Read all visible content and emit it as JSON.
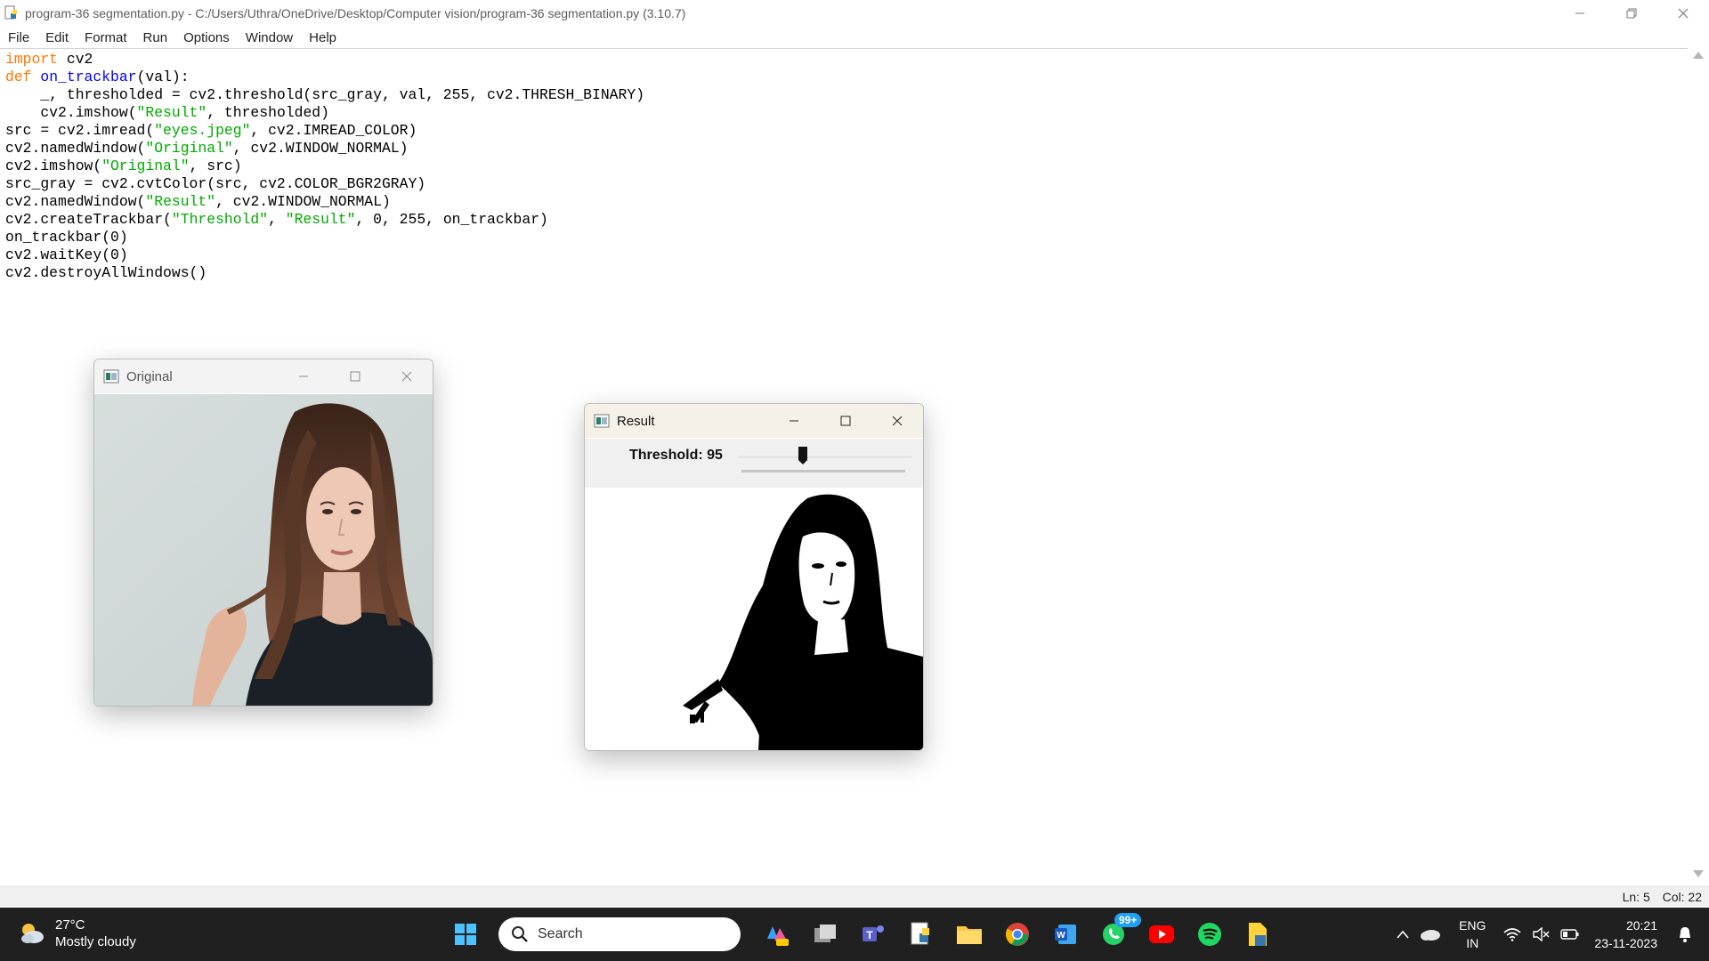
{
  "window": {
    "title": "program-36 segmentation.py - C:/Users/Uthra/OneDrive/Desktop/Computer vision/program-36 segmentation.py (3.10.7)"
  },
  "menu": [
    "File",
    "Edit",
    "Format",
    "Run",
    "Options",
    "Window",
    "Help"
  ],
  "editor": {
    "lines": [
      [
        {
          "t": "import",
          "c": "kw"
        },
        {
          "t": " cv2",
          "c": ""
        }
      ],
      [
        {
          "t": "def",
          "c": "kw"
        },
        {
          "t": " ",
          "c": ""
        },
        {
          "t": "on_trackbar",
          "c": "fn"
        },
        {
          "t": "(val):",
          "c": ""
        }
      ],
      [
        {
          "t": "    _, thresholded = cv2.threshold(src_gray, val, 255, cv2.THRESH_BINARY)",
          "c": ""
        }
      ],
      [
        {
          "t": "    cv2.imshow(",
          "c": ""
        },
        {
          "t": "\"Result\"",
          "c": "st"
        },
        {
          "t": ", thresholded)",
          "c": ""
        }
      ],
      [
        {
          "t": "src = cv2.imread(",
          "c": ""
        },
        {
          "t": "\"eyes.jpeg\"",
          "c": "st"
        },
        {
          "t": ", cv2.IMREAD_COLOR)",
          "c": ""
        }
      ],
      [
        {
          "t": "cv2.namedWindow(",
          "c": ""
        },
        {
          "t": "\"Original\"",
          "c": "st"
        },
        {
          "t": ", cv2.WINDOW_NORMAL)",
          "c": ""
        }
      ],
      [
        {
          "t": "cv2.imshow(",
          "c": ""
        },
        {
          "t": "\"Original\"",
          "c": "st"
        },
        {
          "t": ", src)",
          "c": ""
        }
      ],
      [
        {
          "t": "src_gray = cv2.cvtColor(src, cv2.COLOR_BGR2GRAY)",
          "c": ""
        }
      ],
      [
        {
          "t": "cv2.namedWindow(",
          "c": ""
        },
        {
          "t": "\"Result\"",
          "c": "st"
        },
        {
          "t": ", cv2.WINDOW_NORMAL)",
          "c": ""
        }
      ],
      [
        {
          "t": "cv2.createTrackbar(",
          "c": ""
        },
        {
          "t": "\"Threshold\"",
          "c": "st"
        },
        {
          "t": ", ",
          "c": ""
        },
        {
          "t": "\"Result\"",
          "c": "st"
        },
        {
          "t": ", 0, 255, on_trackbar)",
          "c": ""
        }
      ],
      [
        {
          "t": "on_trackbar(0)",
          "c": ""
        }
      ],
      [
        {
          "t": "cv2.waitKey(0)",
          "c": ""
        }
      ],
      [
        {
          "t": "cv2.destroyAllWindows()",
          "c": ""
        }
      ]
    ]
  },
  "status": {
    "line": "Ln: 5",
    "col": "Col: 22"
  },
  "original_window": {
    "title": "Original"
  },
  "result_window": {
    "title": "Result",
    "trackbar_label": "Threshold: 95",
    "trackbar_value": 95,
    "trackbar_max": 255
  },
  "taskbar": {
    "weather_temp": "27°C",
    "weather_desc": "Mostly cloudy",
    "search_placeholder": "Search",
    "whatsapp_badge": "99+",
    "lang_line1": "ENG",
    "lang_line2": "IN",
    "time": "20:21",
    "date": "23-11-2023"
  },
  "colors": {
    "keyword": "#ff7700",
    "function_name": "#0000ff",
    "string": "#00aa00",
    "taskbar_bg": "#202020"
  }
}
